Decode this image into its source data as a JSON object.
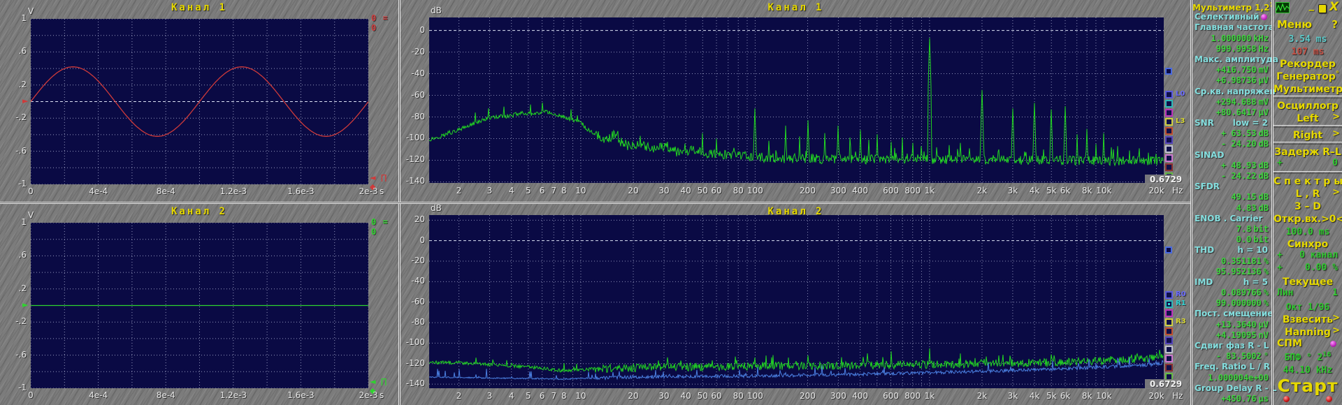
{
  "app": {
    "window_buttons": {
      "minimize": "_",
      "close": "X"
    },
    "icon": "waveform-icon"
  },
  "scope_panels": [
    {
      "title": "Канал 1",
      "ylabel": "V",
      "xunit": "s",
      "yticks": [
        "1",
        ".6",
        ".2",
        "-.2",
        "-.6",
        "-1"
      ],
      "xticks": [
        "0",
        "4e-4",
        "8e-4",
        "1.2e-3",
        "1.6e-3",
        "2e-3"
      ],
      "marker_readout": "0 = 0",
      "cursor_glyphs": "◄ ∏ ◆",
      "trace_marker": "►"
    },
    {
      "title": "Канал 2",
      "ylabel": "V",
      "xunit": "s",
      "yticks": [
        "1",
        ".6",
        ".2",
        "-.2",
        "-.6",
        "-1"
      ],
      "xticks": [
        "0",
        "4e-4",
        "8e-4",
        "1.2e-3",
        "1.6e-3",
        "2e-3"
      ],
      "marker_readout": "0 = 0",
      "cursor_glyphs": "◄ ∏ ◆",
      "trace_marker": "►"
    }
  ],
  "spectrum_axis": {
    "xticks": [
      {
        "f": 2,
        "l": "2"
      },
      {
        "f": 3,
        "l": "3"
      },
      {
        "f": 4,
        "l": "4"
      },
      {
        "f": 5,
        "l": "5"
      },
      {
        "f": 6,
        "l": "6"
      },
      {
        "f": 7,
        "l": "7"
      },
      {
        "f": 8,
        "l": "8"
      },
      {
        "f": 10,
        "l": "10"
      },
      {
        "f": 20,
        "l": "20"
      },
      {
        "f": 30,
        "l": "30"
      },
      {
        "f": 40,
        "l": "40"
      },
      {
        "f": 50,
        "l": "50"
      },
      {
        "f": 60,
        "l": "60"
      },
      {
        "f": 80,
        "l": "80"
      },
      {
        "f": 100,
        "l": "100"
      },
      {
        "f": 200,
        "l": "200"
      },
      {
        "f": 300,
        "l": "300"
      },
      {
        "f": 400,
        "l": "400"
      },
      {
        "f": 600,
        "l": "600"
      },
      {
        "f": 800,
        "l": "800"
      },
      {
        "f": 1000,
        "l": "1k"
      },
      {
        "f": 2000,
        "l": "2k"
      },
      {
        "f": 3000,
        "l": "3k"
      },
      {
        "f": 4000,
        "l": "4k"
      },
      {
        "f": 5000,
        "l": "5k"
      },
      {
        "f": 6000,
        "l": "6k"
      },
      {
        "f": 8000,
        "l": "8k"
      },
      {
        "f": 10000,
        "l": "10k"
      },
      {
        "f": 20000,
        "l": "20k"
      }
    ]
  },
  "spectrum_panels": [
    {
      "title": "Канал 1",
      "ylabel": "dB",
      "xunit": "Hz",
      "bin_width": "0.6729",
      "yticks": [
        "0",
        "-20",
        "-40",
        "-60",
        "-80",
        "-100",
        "-120",
        "-140"
      ],
      "legend": {
        "labels": [
          {
            "i": 0,
            "t": "L0",
            "c": "#6a6aff"
          },
          {
            "i": 3,
            "t": "L3",
            "c": "#d8d833"
          }
        ],
        "dot": -1,
        "colors": [
          "#5a5ae0",
          "#2fb9b9",
          "#bb33bb",
          "#d0d040",
          "#c05030",
          "#5544bb",
          "#c0c0d0",
          "#cc77cc",
          "#8a3030",
          "#66bb44"
        ]
      }
    },
    {
      "title": "Канал 2",
      "ylabel": "dB",
      "xunit": "Hz",
      "bin_width": "0.6729",
      "yticks": [
        "20",
        "0",
        "-20",
        "-40",
        "-60",
        "-80",
        "-100",
        "-120",
        "-140"
      ],
      "legend": {
        "labels": [
          {
            "i": 0,
            "t": "R0",
            "c": "#6a6aff"
          },
          {
            "i": 1,
            "t": "R1",
            "c": "#2fd4d4"
          },
          {
            "i": 3,
            "t": "R3",
            "c": "#d8d833"
          }
        ],
        "dot": 1,
        "colors": [
          "#5a5ae0",
          "#2fb9b9",
          "#bb33bb",
          "#d0d040",
          "#c05030",
          "#5544bb",
          "#c0c0d0",
          "#cc77cc",
          "#8a3030",
          "#66bb44"
        ]
      }
    }
  ],
  "measurements": {
    "rows": [
      {
        "k": "title",
        "t": "Мультиметр 1,2",
        "sup": "?"
      },
      {
        "k": "label",
        "t": "Селективный",
        "led": "#c22ac2"
      },
      {
        "k": "label",
        "t": "Главная частота"
      },
      {
        "k": "val",
        "t": "1.000000",
        "u": "kHz"
      },
      {
        "k": "val",
        "t": "999.9958",
        "u": "Hz"
      },
      {
        "k": "label",
        "t": "Макс. амплитуда"
      },
      {
        "k": "val",
        "t": "+416.750",
        "u": "mV"
      },
      {
        "k": "val",
        "t": "+6.98736",
        "u": "µV"
      },
      {
        "k": "label",
        "t": "Ср.кв. напряжен"
      },
      {
        "k": "val",
        "t": "+294.688",
        "u": "mV"
      },
      {
        "k": "val",
        "t": "+80.6417",
        "u": "µV"
      },
      {
        "k": "label",
        "t": "SNR",
        "r": "low = 2"
      },
      {
        "k": "val",
        "t": "+ 63.53",
        "u": "dB"
      },
      {
        "k": "val",
        "t": "- 24.20",
        "u": "dB"
      },
      {
        "k": "label",
        "t": "SINAD"
      },
      {
        "k": "val",
        "t": "+ 48.93",
        "u": "dB"
      },
      {
        "k": "val",
        "t": "- 24.22",
        "u": "dB"
      },
      {
        "k": "label",
        "t": "SFDR"
      },
      {
        "k": "val",
        "t": "49.15",
        "u": "dB"
      },
      {
        "k": "val",
        "t": "4.83",
        "u": "dB"
      },
      {
        "k": "label",
        "t": "ENOB . Carrier"
      },
      {
        "k": "val",
        "t": "7.8",
        "u": "bit"
      },
      {
        "k": "val",
        "t": "0.0",
        "u": "bit"
      },
      {
        "k": "label",
        "t": "THD",
        "r": "h = 10"
      },
      {
        "k": "val",
        "t": "0.351181",
        "u": "%"
      },
      {
        "k": "val",
        "t": "95.952136",
        "u": "%"
      },
      {
        "k": "label",
        "t": "IMD",
        "r": "h =  5"
      },
      {
        "k": "val",
        "t": "0.089766",
        "u": "%"
      },
      {
        "k": "val",
        "t": "99.000000",
        "u": "%"
      },
      {
        "k": "label",
        "t": "Пост. смещение"
      },
      {
        "k": "val",
        "t": "+13.3640",
        "u": "µV"
      },
      {
        "k": "val",
        "t": "+4.19095",
        "u": "nV"
      },
      {
        "k": "label",
        "t": "Сдвиг фаз R - L"
      },
      {
        "k": "val",
        "t": "-  83.5002",
        "u": "°"
      },
      {
        "k": "label",
        "t": "Freq. Ratio  L / R"
      },
      {
        "k": "val",
        "t": "1.000004e+00",
        "u": ""
      },
      {
        "k": "label",
        "t": "Group Delay R - L"
      },
      {
        "k": "val",
        "t": "+450.76",
        "u": "µs"
      }
    ]
  },
  "controls": {
    "rows": [
      {
        "k": "menu",
        "t": "Меню",
        "r": "?"
      },
      {
        "k": "val",
        "c": "cyan",
        "t": "3.54",
        "u": "ms"
      },
      {
        "k": "val",
        "c": "red",
        "t": "107",
        "u": "ms"
      },
      {
        "k": "btn",
        "t": "Рекордер"
      },
      {
        "k": "btn",
        "t": "Генератор",
        "sup": "°"
      },
      {
        "k": "btn",
        "t": "Мультиметр",
        "hr": true
      },
      {
        "k": "btn",
        "t": "Осциллогр"
      },
      {
        "k": "arrow",
        "t": "Left",
        "r": ">",
        "hr": true
      },
      {
        "k": "arrow",
        "t": "Right",
        "r": ">",
        "hr": true
      },
      {
        "k": "btn",
        "t": "Задерж  R–L"
      },
      {
        "k": "split",
        "t": "+",
        "r": "0",
        "hr": true
      },
      {
        "k": "btn",
        "t": "С п е к т р ы"
      },
      {
        "k": "arrow",
        "t": "L , R",
        "r": ">"
      },
      {
        "k": "btn",
        "t": "3 – D"
      },
      {
        "k": "btn",
        "t": "Откр.вх.>0<"
      },
      {
        "k": "val",
        "c": "green",
        "t": "100.0",
        "u": "ms"
      },
      {
        "k": "btn",
        "t": "Синхро"
      },
      {
        "k": "split",
        "t": "+",
        "r": "0 канал"
      },
      {
        "k": "split",
        "t": "+",
        "r": "0.00 %"
      },
      {
        "k": "btn",
        "t": "Текущее"
      },
      {
        "k": "split",
        "t": "Лин",
        "r": "1"
      },
      {
        "k": "val",
        "c": "green",
        "t": "Окт",
        "u": "1/96"
      },
      {
        "k": "arrow",
        "t": "Взвесить",
        "r": ">"
      },
      {
        "k": "arrow",
        "t": "Hanning",
        "r": ">"
      },
      {
        "k": "led",
        "t": "СПМ",
        "led": "#c22ac2"
      },
      {
        "k": "fft",
        "t": "БПФ ° 2",
        "sup": "16"
      },
      {
        "k": "val",
        "c": "green",
        "t": "44.10",
        "u": "kHz"
      },
      {
        "k": "start",
        "t": "Старт"
      },
      {
        "k": "leds",
        "colors": [
          "#cc1818",
          "#cc1818"
        ]
      }
    ]
  },
  "chart_data": [
    {
      "type": "line",
      "name": "oscilloscope-ch1",
      "title": "Канал 1",
      "xlabel": "s",
      "ylabel": "V",
      "xlim": [
        0,
        0.002
      ],
      "ylim": [
        -1,
        1
      ],
      "signal": "sine",
      "frequency_hz": 1000,
      "amplitude_v": 0.42,
      "offset_v": 0,
      "color": "#cf3a3a"
    },
    {
      "type": "line",
      "name": "oscilloscope-ch2",
      "title": "Канал 2",
      "xlabel": "s",
      "ylabel": "V",
      "xlim": [
        0,
        0.002
      ],
      "ylim": [
        -1,
        1
      ],
      "signal": "dc",
      "level_v": 0,
      "color": "#2fd42f"
    },
    {
      "type": "line",
      "name": "spectrum-ch1",
      "title": "Канал 1",
      "xlabel": "Hz",
      "ylabel": "dB",
      "xscale": "log",
      "xlim": [
        1.35,
        22050
      ],
      "ylim": [
        -140,
        0
      ],
      "series": [
        {
          "name": "L",
          "color": "#22d422",
          "noise_db": 4.5,
          "envelope": [
            [
              1.35,
              -101
            ],
            [
              1.7,
              -96
            ],
            [
              2,
              -92
            ],
            [
              2.6,
              -84
            ],
            [
              3.2,
              -80
            ],
            [
              4,
              -79
            ],
            [
              4.6,
              -76
            ],
            [
              5.4,
              -78
            ],
            [
              6.2,
              -75
            ],
            [
              7,
              -77
            ],
            [
              8,
              -80
            ],
            [
              9,
              -83
            ],
            [
              10,
              -85
            ],
            [
              11,
              -92
            ],
            [
              12.5,
              -97
            ],
            [
              14,
              -102
            ],
            [
              15.5,
              -96
            ],
            [
              17,
              -103
            ],
            [
              19,
              -107
            ],
            [
              22,
              -104
            ],
            [
              26,
              -110
            ],
            [
              30,
              -107
            ],
            [
              36,
              -113
            ],
            [
              45,
              -111
            ],
            [
              60,
              -115
            ],
            [
              80,
              -116
            ],
            [
              120,
              -118
            ],
            [
              300,
              -119
            ],
            [
              1000,
              -119
            ],
            [
              5000,
              -120
            ],
            [
              22050,
              -121
            ]
          ],
          "peaks": [
            [
              50,
              -95
            ],
            [
              60,
              -100
            ],
            [
              100,
              -72
            ],
            [
              120,
              -102
            ],
            [
              150,
              -88
            ],
            [
              180,
              -98
            ],
            [
              200,
              -83
            ],
            [
              250,
              -95
            ],
            [
              300,
              -88
            ],
            [
              350,
              -99
            ],
            [
              400,
              -92
            ],
            [
              450,
              -101
            ],
            [
              500,
              -96
            ],
            [
              600,
              -103
            ],
            [
              700,
              -99
            ],
            [
              800,
              -104
            ],
            [
              900,
              -107
            ],
            [
              1000,
              -7
            ],
            [
              1100,
              -108
            ],
            [
              1300,
              -106
            ],
            [
              1500,
              -104
            ],
            [
              1700,
              -109
            ],
            [
              2000,
              -55
            ],
            [
              2500,
              -110
            ],
            [
              3000,
              -72
            ],
            [
              3500,
              -112
            ],
            [
              4000,
              -67
            ],
            [
              4500,
              -110
            ],
            [
              5000,
              -73
            ],
            [
              6000,
              -70
            ],
            [
              7000,
              -96
            ],
            [
              8000,
              -91
            ],
            [
              9000,
              -105
            ],
            [
              10000,
              -95
            ],
            [
              11000,
              -108
            ],
            [
              12000,
              -107
            ],
            [
              14000,
              -111
            ],
            [
              16000,
              -109
            ],
            [
              18000,
              -113
            ],
            [
              20000,
              -114
            ]
          ]
        }
      ]
    },
    {
      "type": "line",
      "name": "spectrum-ch2",
      "title": "Канал 2",
      "xlabel": "Hz",
      "ylabel": "dB",
      "xscale": "log",
      "xlim": [
        1.35,
        22050
      ],
      "ylim": [
        -140,
        20
      ],
      "series": [
        {
          "name": "R-green",
          "color": "#22d422",
          "noise_db": 4,
          "envelope": [
            [
              1.35,
              -119
            ],
            [
              2,
              -119
            ],
            [
              3,
              -121
            ],
            [
              5,
              -123
            ],
            [
              8,
              -127
            ],
            [
              12,
              -125
            ],
            [
              20,
              -124
            ],
            [
              50,
              -123
            ],
            [
              200,
              -122
            ],
            [
              800,
              -121
            ],
            [
              2000,
              -120
            ],
            [
              5000,
              -119
            ],
            [
              10000,
              -117
            ],
            [
              16000,
              -115
            ],
            [
              22050,
              -113
            ]
          ],
          "peaks": [
            [
              100,
              -114
            ],
            [
              200,
              -112
            ],
            [
              440,
              -110
            ],
            [
              600,
              -108
            ],
            [
              1000,
              -105
            ],
            [
              1500,
              -110
            ],
            [
              2500,
              -112
            ],
            [
              5000,
              -111
            ]
          ]
        },
        {
          "name": "R-blue",
          "color": "#4a7fe0",
          "noise_db": 1.6,
          "envelope": [
            [
              1.35,
              -133
            ],
            [
              3,
              -134
            ],
            [
              8,
              -135
            ],
            [
              20,
              -133
            ],
            [
              100,
              -132
            ],
            [
              500,
              -130
            ],
            [
              1500,
              -128
            ],
            [
              4000,
              -126
            ],
            [
              8000,
              -124
            ],
            [
              15000,
              -122
            ],
            [
              22050,
              -120
            ]
          ],
          "peaks": []
        }
      ]
    }
  ]
}
